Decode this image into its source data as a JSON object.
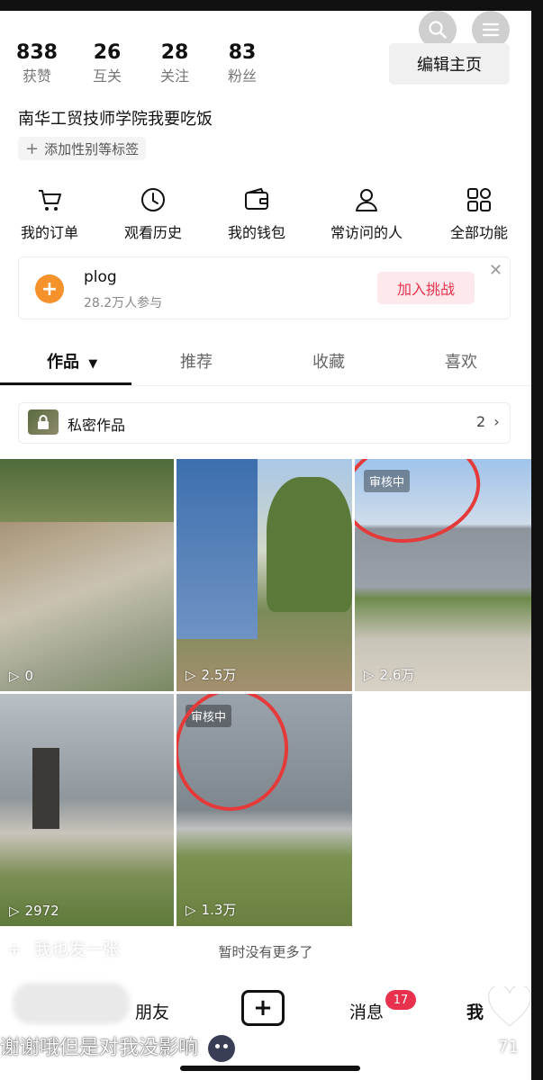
{
  "stats": [
    {
      "value": "838",
      "label": "获赞"
    },
    {
      "value": "26",
      "label": "互关"
    },
    {
      "value": "28",
      "label": "关注"
    },
    {
      "value": "83",
      "label": "粉丝"
    }
  ],
  "edit_profile_label": "编辑主页",
  "username": "南华工贸技师学院我要吃饭",
  "add_tag_label": "添加性别等标签",
  "quick_actions": [
    {
      "label": "我的订单",
      "icon": "cart-icon"
    },
    {
      "label": "观看历史",
      "icon": "clock-icon"
    },
    {
      "label": "我的钱包",
      "icon": "wallet-icon"
    },
    {
      "label": "常访问的人",
      "icon": "person-icon"
    },
    {
      "label": "全部功能",
      "icon": "grid-icon"
    }
  ],
  "challenge": {
    "title": "plog",
    "participants": "28.2万人参与",
    "join_label": "加入挑战"
  },
  "tabs": [
    {
      "label": "作品",
      "active": true
    },
    {
      "label": "推荐",
      "active": false
    },
    {
      "label": "收藏",
      "active": false
    },
    {
      "label": "喜欢",
      "active": false
    }
  ],
  "private_works": {
    "label": "私密作品",
    "count": "2"
  },
  "videos": [
    {
      "plays": "0",
      "status": ""
    },
    {
      "plays": "2.5万",
      "status": ""
    },
    {
      "plays": "2.6万",
      "status": "审核中"
    },
    {
      "plays": "2972",
      "status": ""
    },
    {
      "plays": "1.3万",
      "status": "审核中"
    }
  ],
  "no_more_text": "暂时没有更多了",
  "also_post_text": "我也发一张",
  "bottom_nav": {
    "friends": "朋友",
    "messages": "消息",
    "me": "我",
    "messages_badge": "17"
  },
  "comment_text": "谢谢哦但是对我没影响",
  "like_count": "71",
  "colors": {
    "accent_red": "#e8314d",
    "annotation_red": "#e53a3a",
    "plog_orange": "#f5922b"
  }
}
